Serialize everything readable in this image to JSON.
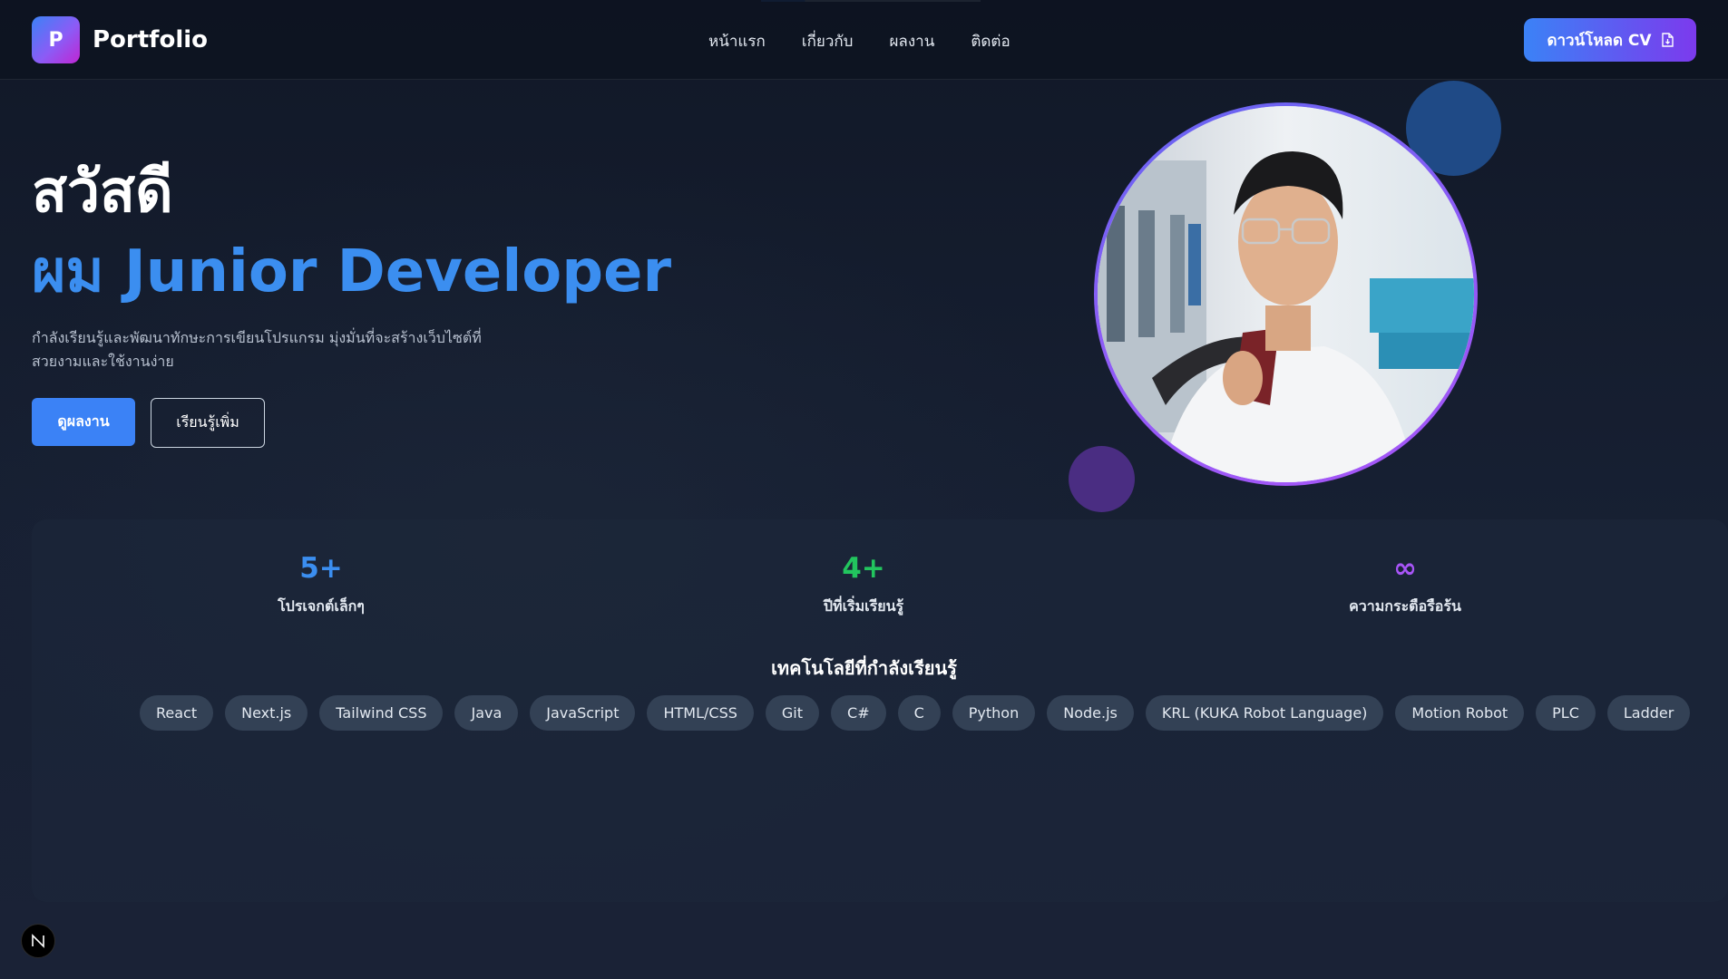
{
  "header": {
    "logo_letter": "P",
    "logo_text": "Portfolio",
    "nav": [
      "หน้าแรก",
      "เกี่ยวกับ",
      "ผลงาน",
      "ติดต่อ"
    ],
    "cv_button": "ดาวน์โหลด CV"
  },
  "hero": {
    "greeting": "สวัสดี",
    "role": "ผม Junior Developer",
    "description": "กำลังเรียนรู้และพัฒนาทักษะการเขียนโปรแกรม มุ่งมั่นที่จะสร้างเว็บไซต์ที่สวยงามและใช้งานง่าย",
    "primary_button": "ดูผลงาน",
    "secondary_button": "เรียนรู้เพิ่ม"
  },
  "stats": [
    {
      "value": "5+",
      "label": "โปรเจกต์เล็กๆ",
      "color": "#3b8ef0"
    },
    {
      "value": "4+",
      "label": "ปีที่เริ่มเรียนรู้",
      "color": "#22c55e"
    },
    {
      "value": "∞",
      "label": "ความกระตือรือร้น",
      "color": "#a855f7"
    }
  ],
  "tech": {
    "title": "เทคโนโลยีที่กำลังเรียนรู้",
    "items": [
      "React",
      "Next.js",
      "Tailwind CSS",
      "Java",
      "JavaScript",
      "HTML/CSS",
      "Git",
      "C#",
      "C",
      "Python",
      "Node.js",
      "KRL (KUKA Robot Language)",
      "Motion Robot",
      "PLC",
      "Ladder"
    ]
  },
  "badge": "N",
  "colors": {
    "accent": "#3b82f6",
    "accent_purple": "#7c3aed",
    "background": "#141c2c"
  }
}
